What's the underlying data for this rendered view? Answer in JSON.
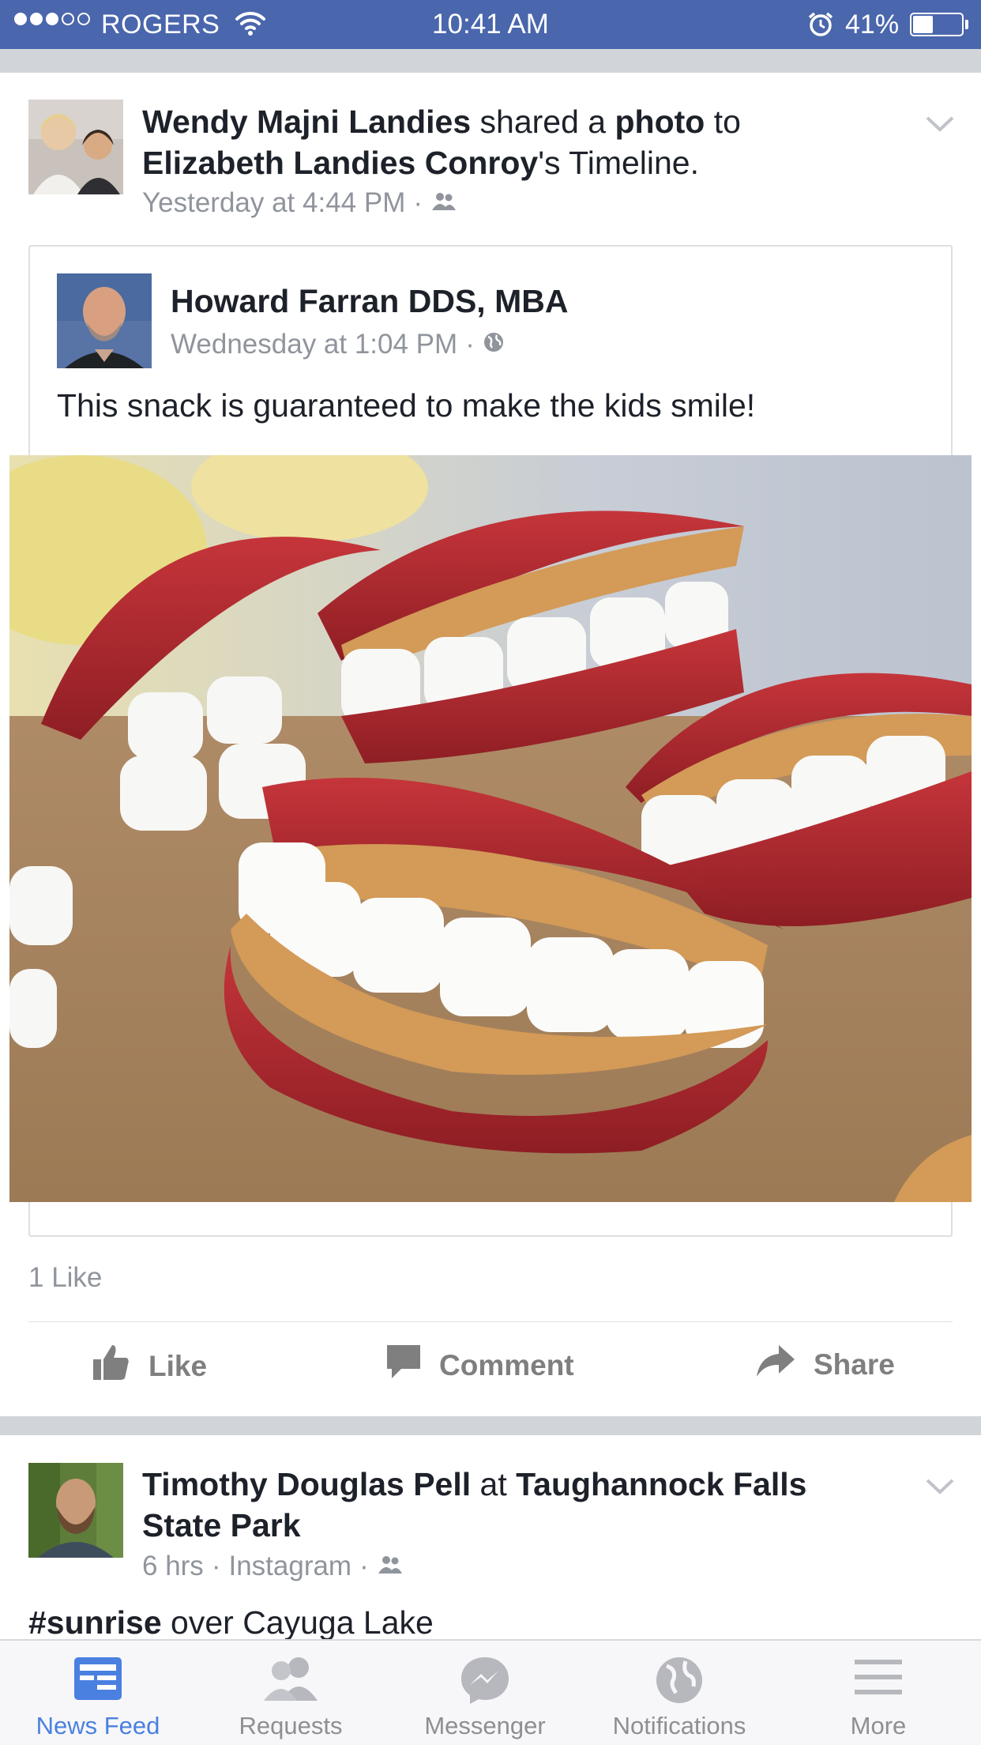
{
  "status_bar": {
    "carrier": "ROGERS",
    "time": "10:41 AM",
    "battery_percent": "41%",
    "battery_level": 0.41
  },
  "post1": {
    "author": "Wendy Majni Landies",
    "action_text": " shared a ",
    "object": "photo",
    "to_text": " to",
    "target": "Elizabeth Landies Conroy",
    "target_suffix": "'s Timeline.",
    "timestamp": "Yesterday at 4:44 PM",
    "shared": {
      "author": "Howard Farran DDS, MBA",
      "timestamp": "Wednesday at 1:04 PM",
      "text": "This snack is guaranteed to make the kids smile!"
    },
    "likes": "1 Like",
    "actions": {
      "like": "Like",
      "comment": "Comment",
      "share": "Share"
    }
  },
  "post2": {
    "author": "Timothy Douglas Pell",
    "at_text": " at ",
    "place_line1": "Taughannock Falls",
    "place_line2": "State Park",
    "timestamp": "6 hrs",
    "source": "Instagram",
    "hashtag": "#sunrise",
    "caption_rest": " over Cayuga Lake"
  },
  "tab_bar": {
    "tabs": [
      {
        "label": "News Feed",
        "icon": "news-feed-icon",
        "active": true
      },
      {
        "label": "Requests",
        "icon": "friend-requests-icon",
        "active": false
      },
      {
        "label": "Messenger",
        "icon": "messenger-icon",
        "active": false
      },
      {
        "label": "Notifications",
        "icon": "globe-icon",
        "active": false
      },
      {
        "label": "More",
        "icon": "hamburger-icon",
        "active": false
      }
    ]
  },
  "colors": {
    "brand_blue": "#4a66ac",
    "active_tab": "#4a80e0",
    "meta_gray": "#90949c",
    "band_gray": "#d1d4d9"
  }
}
